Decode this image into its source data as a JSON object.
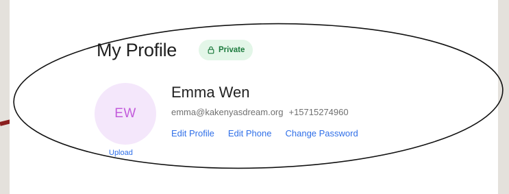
{
  "profile": {
    "title": "My Profile",
    "privacy_badge": "Private",
    "avatar_initials": "EW",
    "upload_label": "Upload",
    "name": "Emma Wen",
    "email": "emma@kakenyasdream.org",
    "phone": "+15715274960"
  },
  "actions": {
    "edit_profile": "Edit Profile",
    "edit_phone": "Edit Phone",
    "change_password": "Change Password"
  },
  "icons": {
    "badge": "lock-icon"
  },
  "colors": {
    "link": "#2f6fe8",
    "badge_bg": "#e3f6e8",
    "badge_text": "#1c7a3d",
    "avatar_bg": "#f4e7fb",
    "avatar_text": "#c25bdb",
    "annotation_line": "#8a1e1e"
  }
}
